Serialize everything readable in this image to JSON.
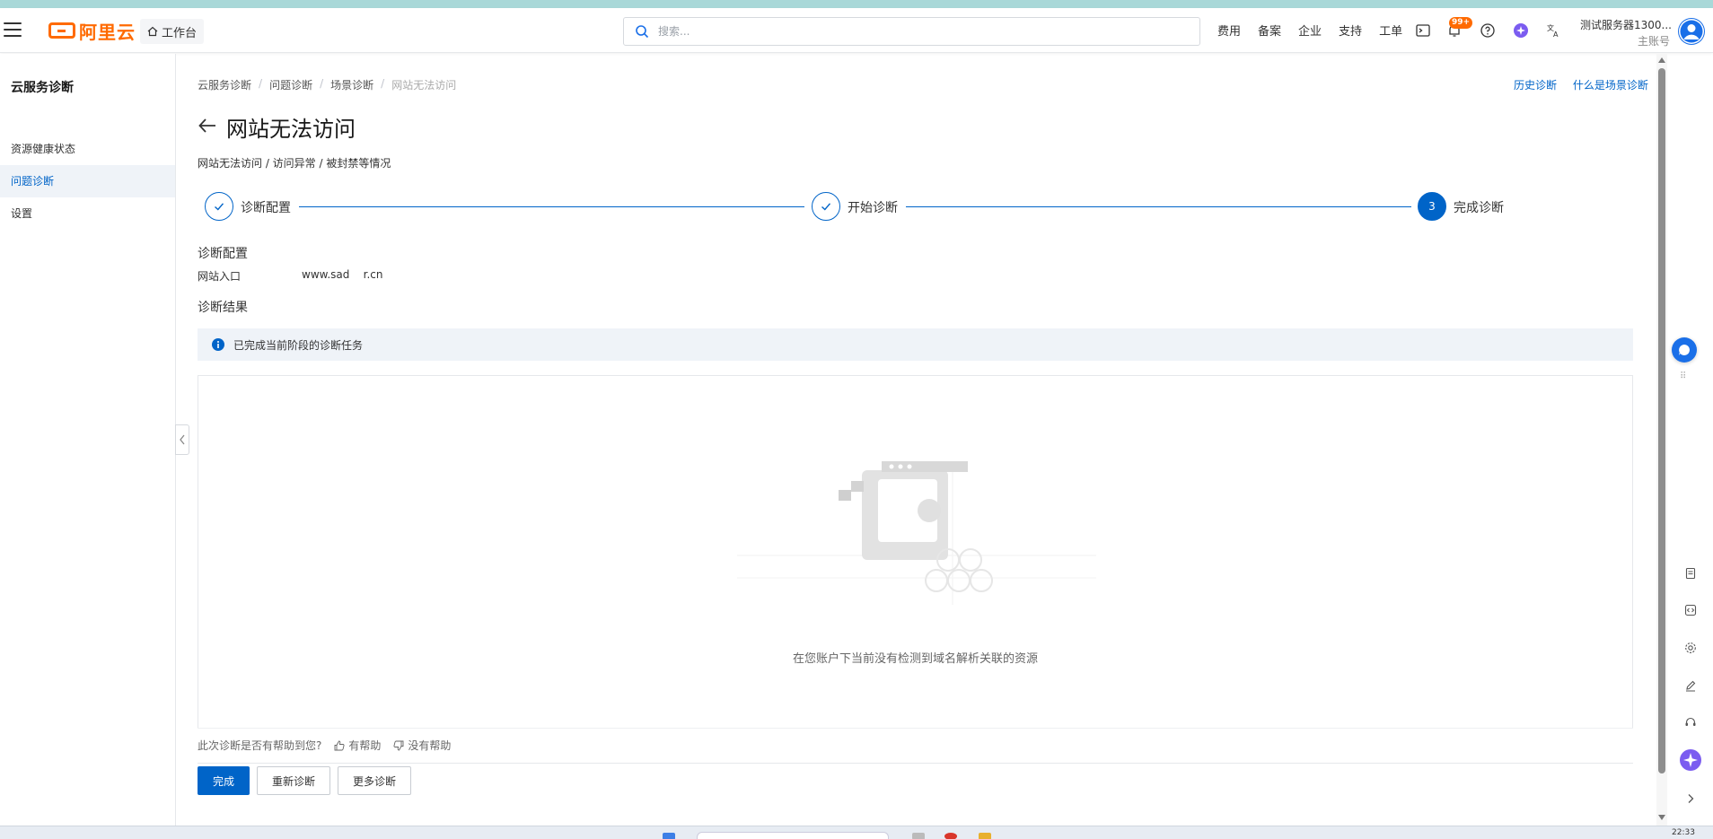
{
  "header": {
    "logo_text": "阿里云",
    "workbench_label": "工作台",
    "search_placeholder": "搜索...",
    "nav_links": [
      "费用",
      "备案",
      "企业",
      "支持",
      "工单"
    ],
    "notification_badge": "99+",
    "account_name": "测试服务器1300...",
    "account_type": "主账号",
    "brand_color": "#ff6a00"
  },
  "sidebar": {
    "title": "云服务诊断",
    "items": [
      {
        "label": "资源健康状态",
        "active": false
      },
      {
        "label": "问题诊断",
        "active": true
      },
      {
        "label": "设置",
        "active": false
      }
    ]
  },
  "main": {
    "breadcrumb": [
      "云服务诊断",
      "问题诊断",
      "场景诊断",
      "网站无法访问"
    ],
    "top_links": [
      "历史诊断",
      "什么是场景诊断"
    ],
    "title": "网站无法访问",
    "subtitle": "网站无法访问 / 访问异常 / 被封禁等情况",
    "steps": [
      {
        "label": "诊断配置",
        "status": "done"
      },
      {
        "label": "开始诊断",
        "status": "done"
      },
      {
        "label": "完成诊断",
        "status": "current",
        "number": "3"
      }
    ],
    "config_heading": "诊断配置",
    "config_key": "网站入口",
    "config_value": "www.sad    r.cn",
    "result_heading": "诊断结果",
    "alert_text": "已完成当前阶段的诊断任务",
    "empty_text": "在您账户下当前没有检测到域名解析关联的资源",
    "feedback_question": "此次诊断是否有帮助到您?",
    "helpful_label": "有帮助",
    "not_helpful_label": "没有帮助",
    "buttons": {
      "finish": "完成",
      "rediagnose": "重新诊断",
      "more": "更多诊断"
    },
    "accent_color": "#0064c8"
  },
  "taskbar": {
    "clock": "22:33"
  }
}
